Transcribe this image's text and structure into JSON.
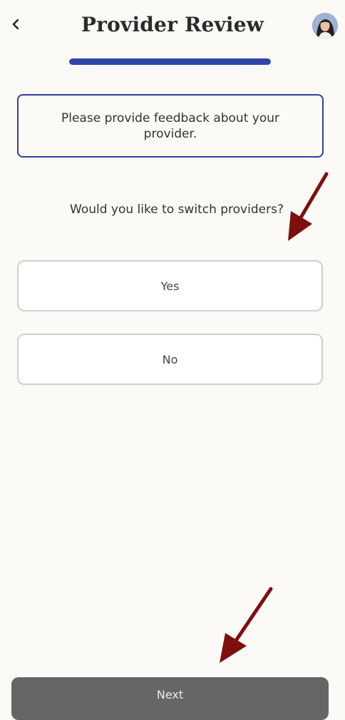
{
  "header": {
    "title": "Provider Review"
  },
  "progress": {
    "fraction": 1.0,
    "color": "#2f45a8"
  },
  "info_box": {
    "text": "Please provide feedback about your provider."
  },
  "question": {
    "text": "Would you like to switch providers?"
  },
  "options": [
    {
      "label": "Yes"
    },
    {
      "label": "No"
    }
  ],
  "footer": {
    "next_label": "Next"
  },
  "icons": {
    "back": "chevron-left-icon",
    "avatar": "user-avatar",
    "annotation": "arrow-pointer-icon"
  },
  "colors": {
    "background": "#fcfaf6",
    "accent": "#2f45a8",
    "info_border": "#31409a",
    "next_button": "#666666",
    "annotation_arrow": "#7d0f0f"
  }
}
